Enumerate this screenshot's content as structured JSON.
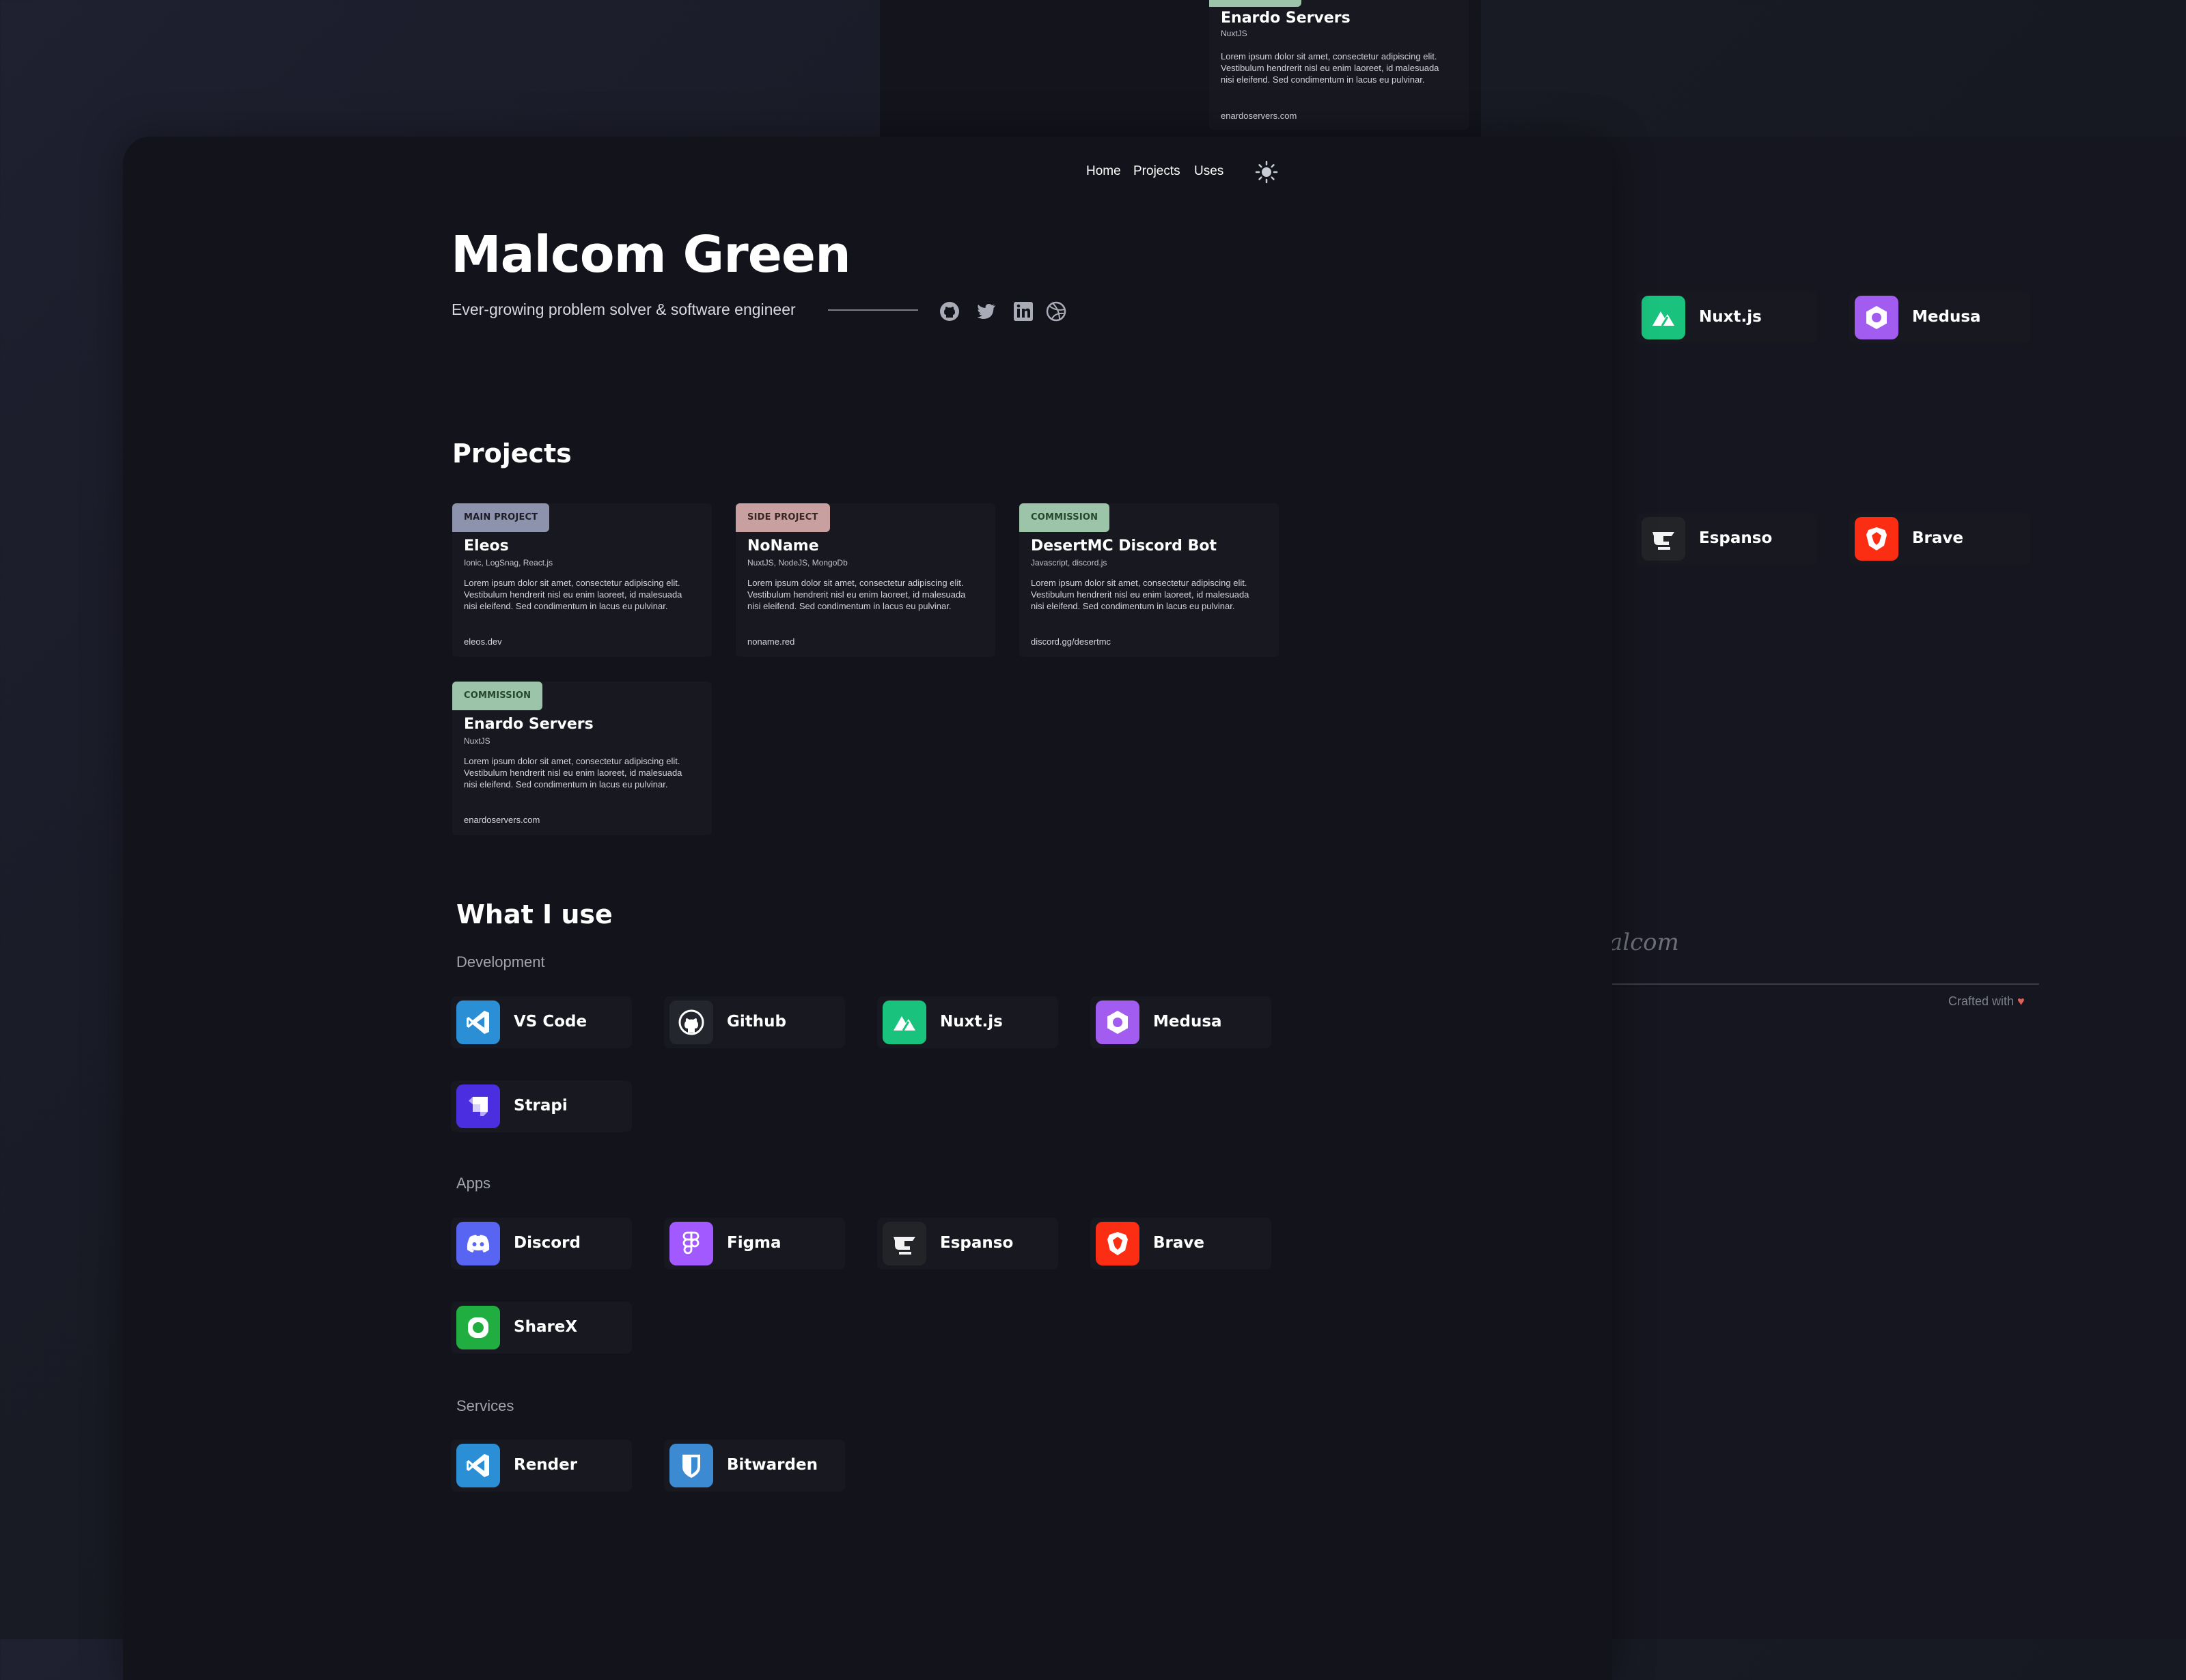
{
  "nav": {
    "home": "Home",
    "projects": "Projects",
    "uses": "Uses"
  },
  "hero": {
    "name": "Malcom Green",
    "tagline": "Ever-growing problem solver & software engineer",
    "socials": [
      "github-icon",
      "twitter-icon",
      "linkedin-icon",
      "dribbble-icon"
    ]
  },
  "projects": {
    "title": "Projects",
    "items": [
      {
        "badge": "MAIN PROJECT",
        "title": "Eleos",
        "tech": "Ionic, LogSnag, React.js",
        "desc": "Lorem ipsum dolor sit amet, consectetur adipiscing elit. Vestibulum hendrerit nisl eu enim laoreet, id malesuada nisi eleifend. Sed condimentum in lacus eu pulvinar.",
        "link": "eleos.dev",
        "badge_color": "#8e93ad"
      },
      {
        "badge": "SIDE PROJECT",
        "title": "NoName",
        "tech": "NuxtJS, NodeJS, MongoDb",
        "desc": "Lorem ipsum dolor sit amet, consectetur adipiscing elit. Vestibulum hendrerit nisl eu enim laoreet, id malesuada nisi eleifend. Sed condimentum in lacus eu pulvinar.",
        "link": "noname.red",
        "badge_color": "#c9a0a0"
      },
      {
        "badge": "COMMISSION",
        "title": "DesertMC Discord Bot",
        "tech": "Javascript, discord.js",
        "desc": "Lorem ipsum dolor sit amet, consectetur adipiscing elit. Vestibulum hendrerit nisl eu enim laoreet, id malesuada nisi eleifend. Sed condimentum in lacus eu pulvinar.",
        "link": "discord.gg/desertmc",
        "badge_color": "#9cc4a8"
      },
      {
        "badge": "COMMISSION",
        "title": "Enardo Servers",
        "tech": "NuxtJS",
        "desc": "Lorem ipsum dolor sit amet, consectetur adipiscing elit. Vestibulum hendrerit nisl eu enim laoreet, id malesuada nisi eleifend. Sed condimentum in lacus eu pulvinar.",
        "link": "enardoservers.com",
        "badge_color": "#9cc4a8"
      }
    ]
  },
  "uses": {
    "title": "What I use",
    "development_label": "Development",
    "development": [
      {
        "name": "VS Code",
        "icon": "vscode-icon",
        "color": "#2b8fd6"
      },
      {
        "name": "Github",
        "icon": "github-icon",
        "color": "#24262d"
      },
      {
        "name": "Nuxt.js",
        "icon": "nuxt-icon",
        "color": "#19c37d"
      },
      {
        "name": "Medusa",
        "icon": "medusa-icon",
        "color": "#a35cf0"
      },
      {
        "name": "Strapi",
        "icon": "strapi-icon",
        "color": "#4a2ee0"
      }
    ],
    "apps_label": "Apps",
    "apps": [
      {
        "name": "Discord",
        "icon": "discord-icon",
        "color": "#5865f2"
      },
      {
        "name": "Figma",
        "icon": "figma-icon",
        "color": "#a259ff"
      },
      {
        "name": "Espanso",
        "icon": "espanso-icon",
        "color": "#232428"
      },
      {
        "name": "Brave",
        "icon": "brave-icon",
        "color": "#fb2e14"
      },
      {
        "name": "ShareX",
        "icon": "sharex-icon",
        "color": "#1fae3f"
      }
    ],
    "services_label": "Services",
    "services": [
      {
        "name": "Render",
        "icon": "render-icon",
        "color": "#2b8fd6"
      },
      {
        "name": "Bitwarden",
        "icon": "bitwarden-icon",
        "color": "#3c8ad2"
      }
    ]
  },
  "backdrop": {
    "top_card": {
      "title": "Enardo Servers",
      "tech": "NuxtJS",
      "desc": "Lorem ipsum dolor sit amet, consectetur adipiscing elit. Vestibulum hendrerit nisl eu enim laoreet, id malesuada nisi eleifend. Sed condimentum in lacus eu pulvinar.",
      "link": "enardoservers.com"
    },
    "right_tools": [
      {
        "name": "Nuxt.js",
        "icon": "nuxt-icon",
        "color": "#19c37d"
      },
      {
        "name": "Medusa",
        "icon": "medusa-icon",
        "color": "#a35cf0"
      },
      {
        "name": "Espanso",
        "icon": "espanso-icon",
        "color": "#232428"
      },
      {
        "name": "Brave",
        "icon": "brave-icon",
        "color": "#fb2e14"
      }
    ],
    "signature": "alcom",
    "crafted": "Crafted with"
  }
}
